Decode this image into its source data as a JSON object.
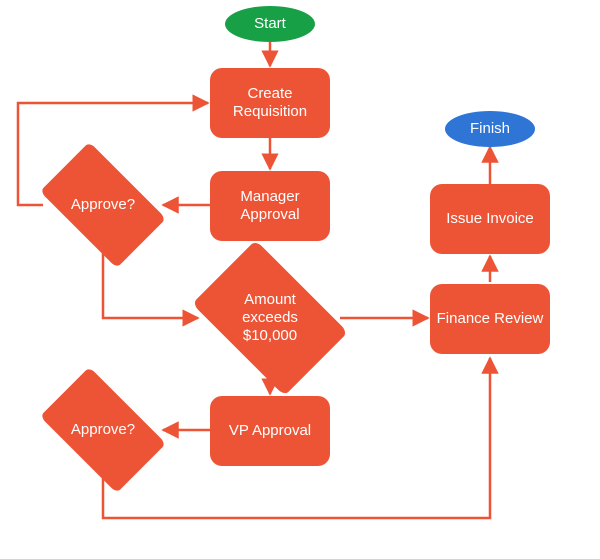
{
  "colors": {
    "node": "#ED5436",
    "start": "#17A046",
    "finish": "#2E75D6",
    "stroke": "#ED5436"
  },
  "nodes": {
    "start": "Start",
    "create_requisition": "Create Requisition",
    "manager_approval": "Manager Approval",
    "approve1": "Approve?",
    "amount_exceeds": "Amount exceeds $10,000",
    "vp_approval": "VP Approval",
    "approve2": "Approve?",
    "finance_review": "Finance Review",
    "issue_invoice": "Issue Invoice",
    "finish": "Finish"
  }
}
